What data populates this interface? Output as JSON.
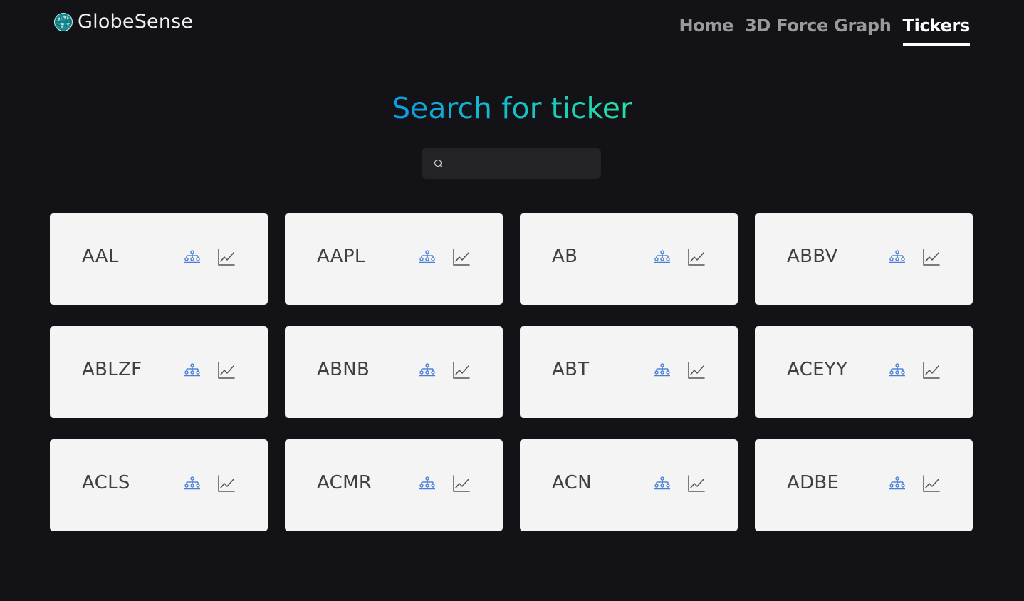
{
  "brand": {
    "name": "GlobeSense",
    "logo_icon": "globe-icon"
  },
  "nav": {
    "items": [
      {
        "label": "Home",
        "active": false
      },
      {
        "label": "3D Force Graph",
        "active": false
      },
      {
        "label": "Tickers",
        "active": true
      }
    ]
  },
  "title": "Search for ticker",
  "search": {
    "placeholder": "",
    "value": "",
    "icon": "search-icon"
  },
  "colors": {
    "background": "#131317",
    "card": "#f4f4f5",
    "title_gradient_start": "#0e9be6",
    "title_gradient_end": "#26e0a5",
    "network_icon": "#4a7fd8",
    "chart_icon": "#555555"
  },
  "card_icons": {
    "network": "network-tree-icon",
    "chart": "line-chart-icon"
  },
  "tickers": [
    "AAL",
    "AAPL",
    "AB",
    "ABBV",
    "ABLZF",
    "ABNB",
    "ABT",
    "ACEYY",
    "ACLS",
    "ACMR",
    "ACN",
    "ADBE"
  ]
}
